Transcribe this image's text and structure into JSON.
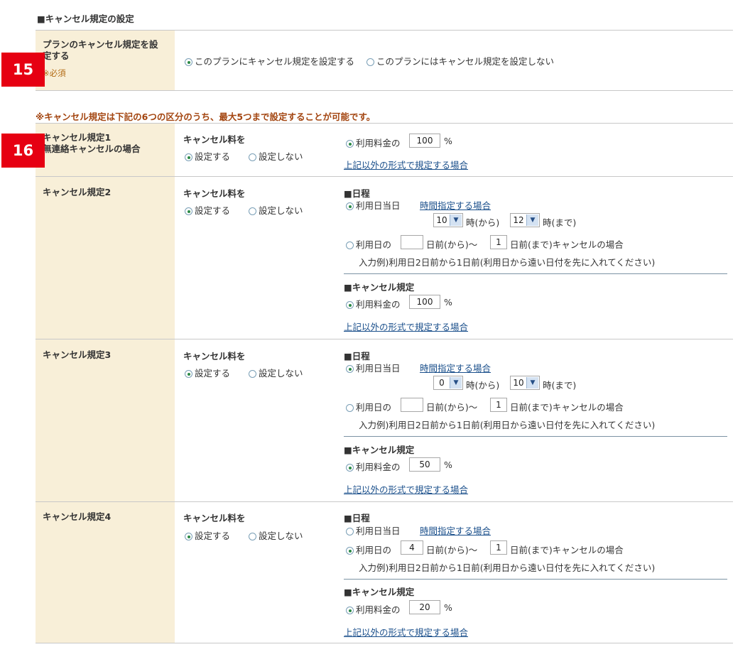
{
  "section_title": "■キャンセル規定の設定",
  "badges": [
    "15",
    "16"
  ],
  "plan_row": {
    "label": "プランのキャンセル規定を設定する",
    "label_line1": "プランのキャンセル規定を設",
    "label_line2": "定する",
    "required": "※必須",
    "option_set": "このプランにキャンセル規定を設定する",
    "option_unset": "このプランにはキャンセル規定を設定しない",
    "selected": "set"
  },
  "notice": "※キャンセル規定は下記の6つの区分のうち、最大5つまで設定することが可能です。",
  "common": {
    "fee_heading": "キャンセル料を",
    "set": "設定する",
    "unset": "設定しない",
    "schedule_heading": "■日程",
    "same_day": "利用日当日",
    "time_link": "時間指定する場合",
    "from_time": "時(から)",
    "to_time": "時(まで)",
    "days_prefix": "利用日の",
    "days_from": "日前(から)～",
    "days_to": "日前(まで)キャンセルの場合",
    "example": "入力例)利用日2日前から1日前(利用日から遠い日付を先に入れてください)",
    "rule_heading": "■キャンセル規定",
    "fee_prefix": "利用料金の",
    "percent": "%",
    "other_link": "上記以外の形式で規定する場合"
  },
  "rules": [
    {
      "title_line1": "キャンセル規定1",
      "title_line2": "無連絡キャンセルの場合",
      "fee_set": true,
      "percent_value": "100"
    },
    {
      "title_line1": "キャンセル規定2",
      "fee_set": true,
      "mode": "same_day",
      "hour_from": "10",
      "hour_to": "12",
      "days_from_value": "",
      "days_to_value": "1",
      "percent_value": "100"
    },
    {
      "title_line1": "キャンセル規定3",
      "fee_set": true,
      "mode": "same_day",
      "hour_from": "0",
      "hour_to": "10",
      "days_from_value": "",
      "days_to_value": "1",
      "percent_value": "50"
    },
    {
      "title_line1": "キャンセル規定4",
      "fee_set": true,
      "mode": "days",
      "days_from_value": "4",
      "days_to_value": "1",
      "percent_value": "20"
    }
  ],
  "colors": {
    "label_bg": "#f8efd8",
    "badge_bg": "#e60012",
    "notice_text": "#a34510",
    "link": "#1a4f8b"
  }
}
